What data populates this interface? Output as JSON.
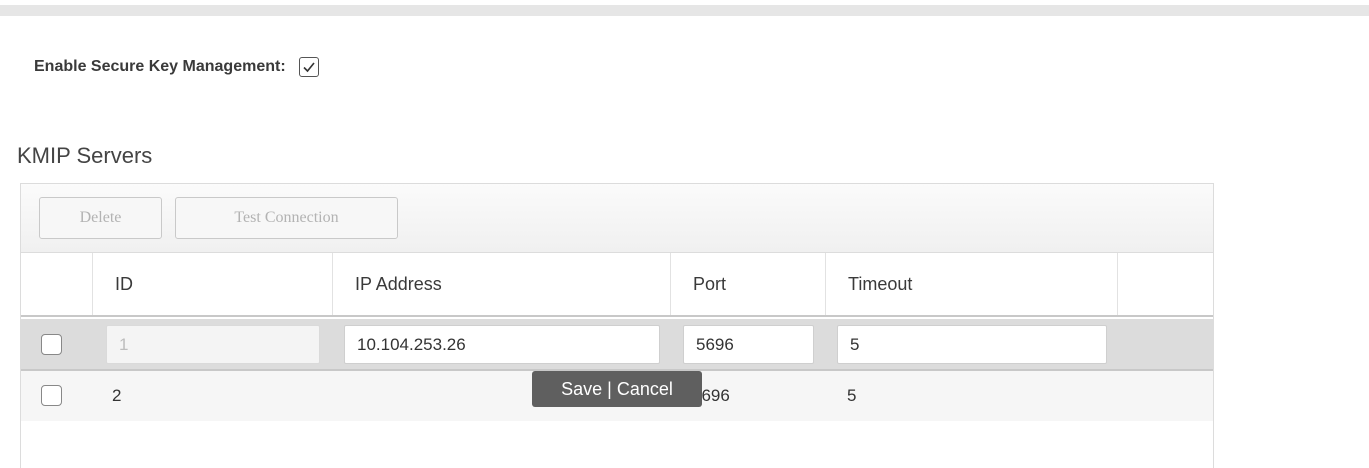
{
  "settings": {
    "enable_label": "Enable Secure Key Management:",
    "enable_checked": true
  },
  "kmip": {
    "title": "KMIP Servers",
    "toolbar": {
      "delete_label": "Delete",
      "test_label": "Test Connection"
    },
    "columns": [
      "ID",
      "IP Address",
      "Port",
      "Timeout"
    ],
    "rows": [
      {
        "id": "1",
        "ip": "10.104.253.26",
        "port": "5696",
        "timeout": "5",
        "editing": true,
        "checked": false
      },
      {
        "id": "2",
        "ip": "",
        "port": "5696",
        "timeout": "5",
        "editing": false,
        "checked": false
      }
    ],
    "edit_tooltip": {
      "save_label": "Save",
      "separator": "|",
      "cancel_label": "Cancel"
    }
  },
  "colors": {
    "edit_row_bg": "#dcdcdc",
    "tooltip_bg": "#5f5f5f"
  }
}
